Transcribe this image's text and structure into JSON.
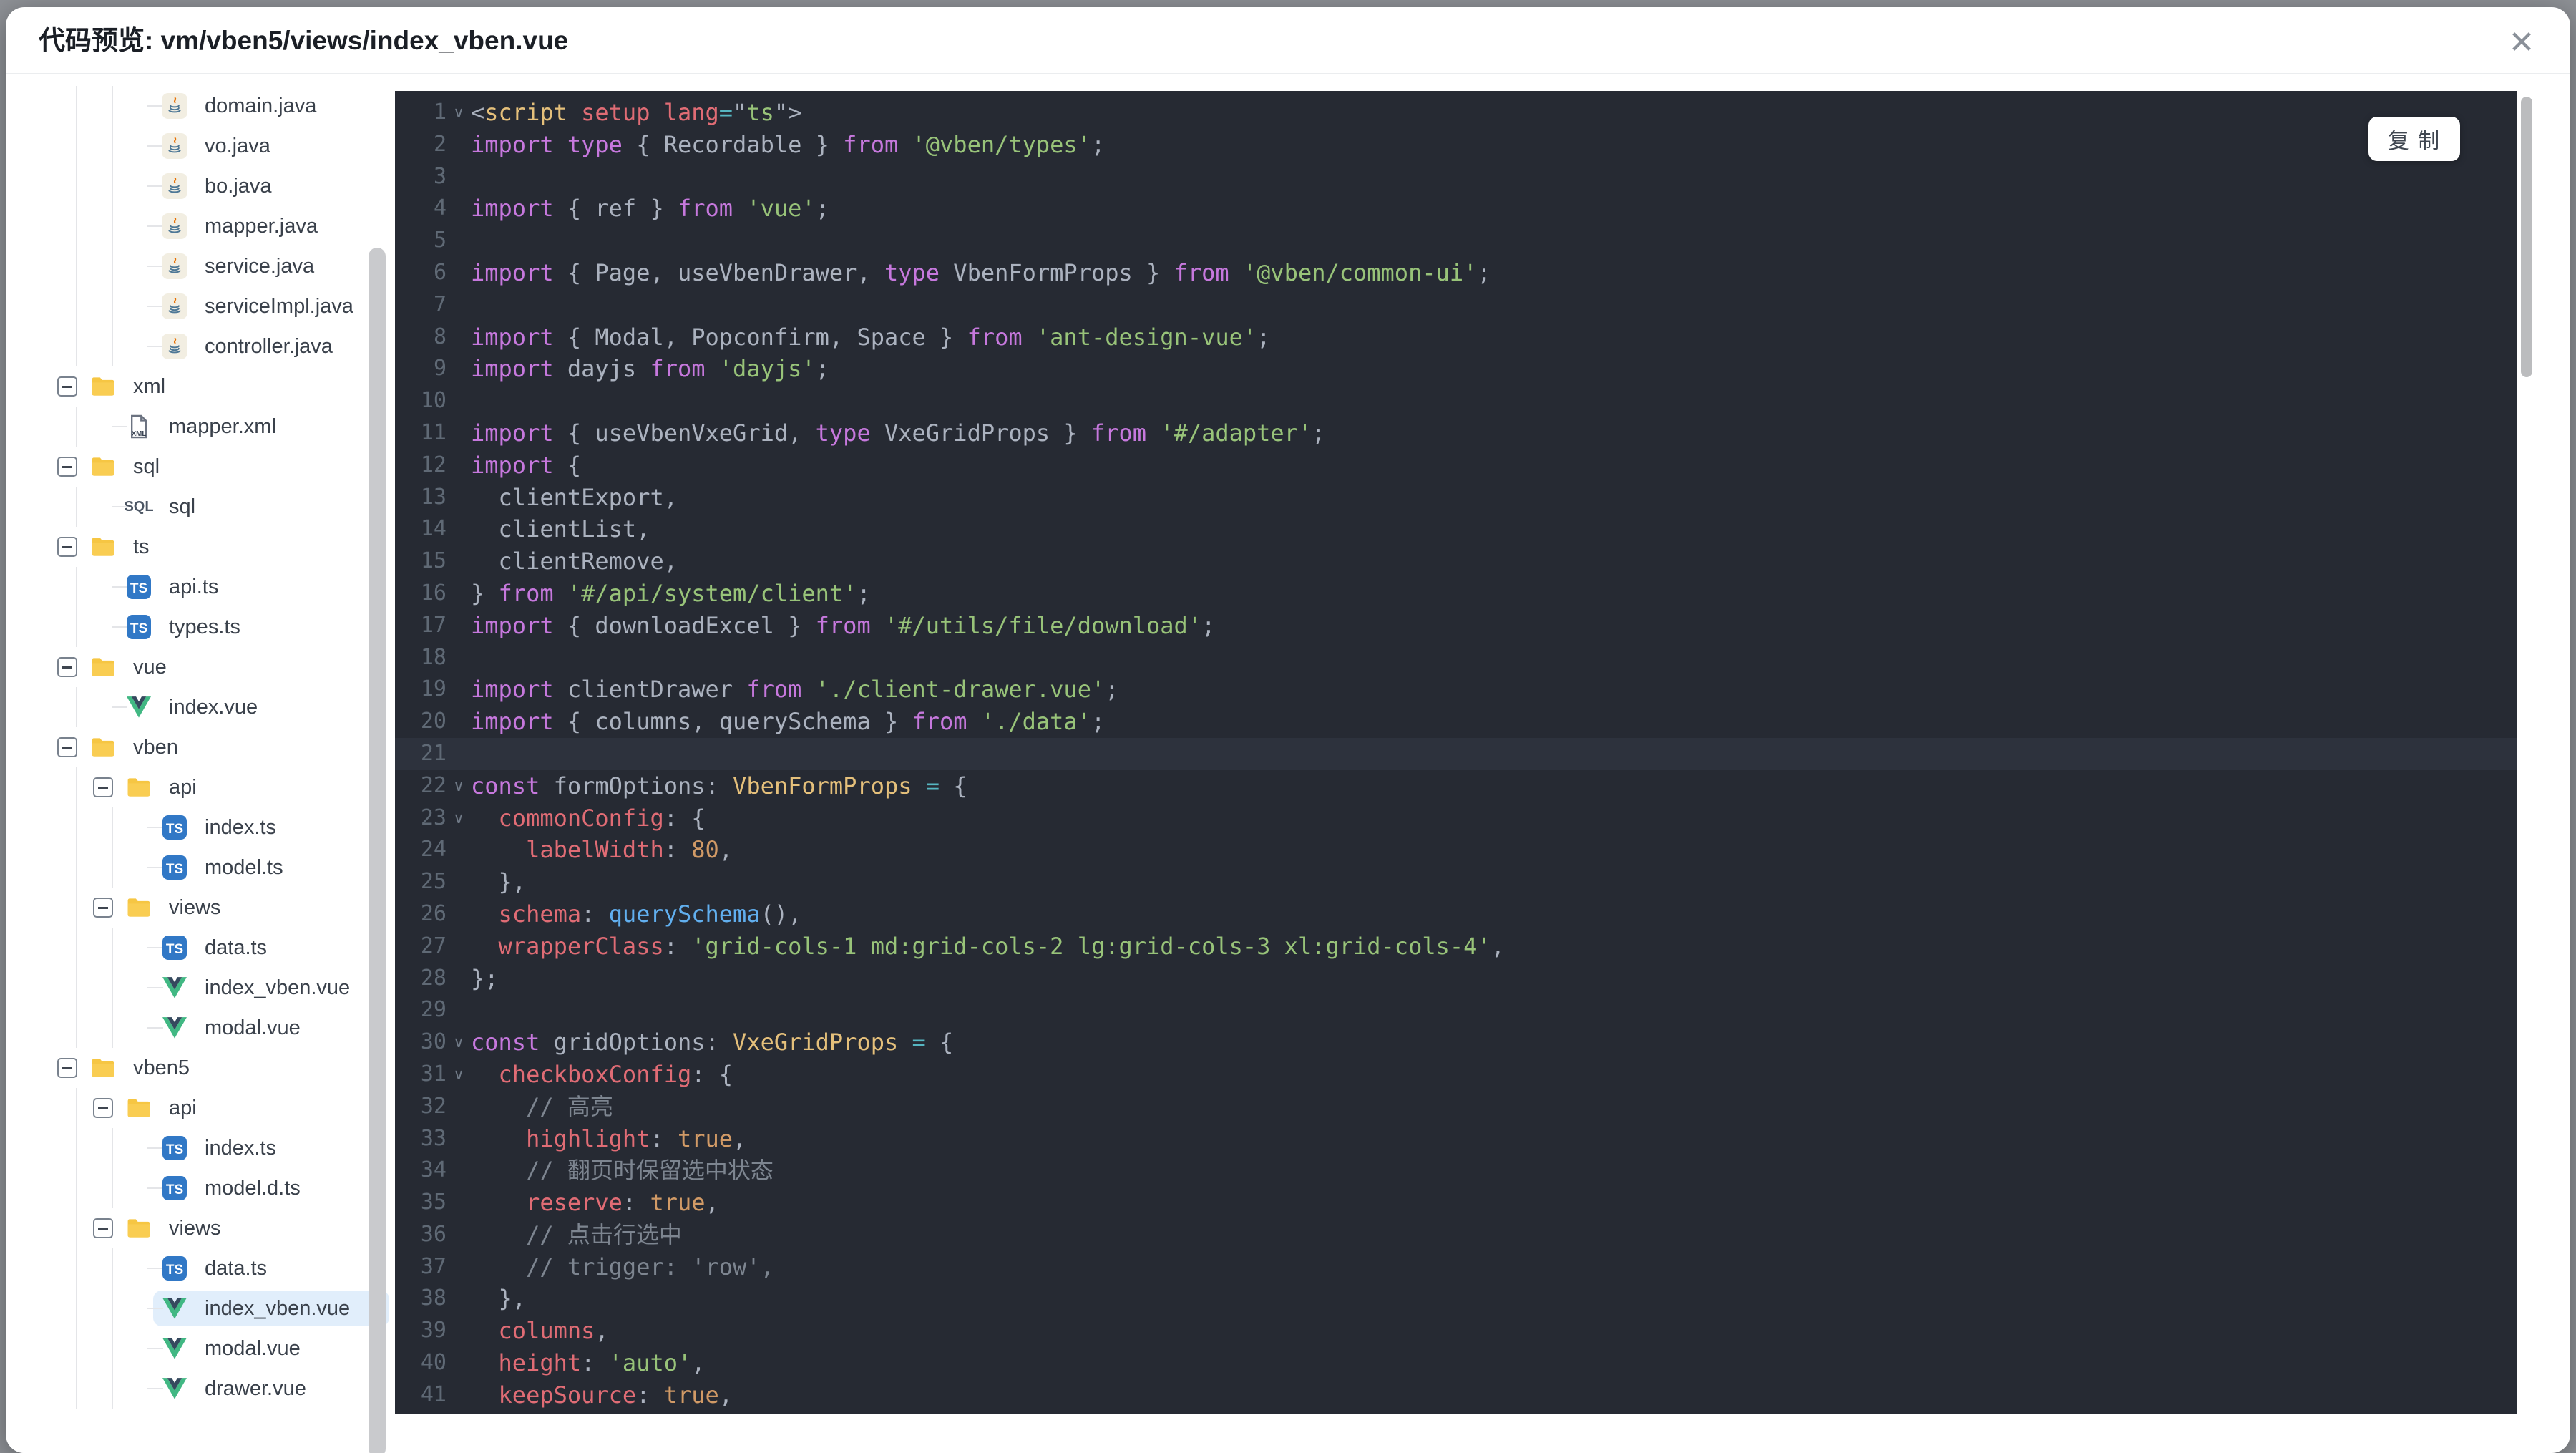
{
  "header": {
    "title": "代码预览: vm/vben5/views/index_vben.vue",
    "close_icon": "✕"
  },
  "tree": {
    "items": [
      {
        "label": "domain.java",
        "icon": "java",
        "depth": 3,
        "kind": "file"
      },
      {
        "label": "vo.java",
        "icon": "java",
        "depth": 3,
        "kind": "file"
      },
      {
        "label": "bo.java",
        "icon": "java",
        "depth": 3,
        "kind": "file"
      },
      {
        "label": "mapper.java",
        "icon": "java",
        "depth": 3,
        "kind": "file"
      },
      {
        "label": "service.java",
        "icon": "java",
        "depth": 3,
        "kind": "file"
      },
      {
        "label": "serviceImpl.java",
        "icon": "java",
        "depth": 3,
        "kind": "file"
      },
      {
        "label": "controller.java",
        "icon": "java",
        "depth": 3,
        "kind": "file"
      },
      {
        "label": "xml",
        "icon": "folder",
        "depth": 1,
        "kind": "folder",
        "expanded": true
      },
      {
        "label": "mapper.xml",
        "icon": "xml",
        "depth": 2,
        "kind": "file"
      },
      {
        "label": "sql",
        "icon": "folder",
        "depth": 1,
        "kind": "folder",
        "expanded": true
      },
      {
        "label": "sql",
        "icon": "sql",
        "depth": 2,
        "kind": "file"
      },
      {
        "label": "ts",
        "icon": "folder",
        "depth": 1,
        "kind": "folder",
        "expanded": true
      },
      {
        "label": "api.ts",
        "icon": "ts",
        "depth": 2,
        "kind": "file"
      },
      {
        "label": "types.ts",
        "icon": "ts",
        "depth": 2,
        "kind": "file"
      },
      {
        "label": "vue",
        "icon": "folder",
        "depth": 1,
        "kind": "folder",
        "expanded": true
      },
      {
        "label": "index.vue",
        "icon": "vue",
        "depth": 2,
        "kind": "file"
      },
      {
        "label": "vben",
        "icon": "folder",
        "depth": 1,
        "kind": "folder",
        "expanded": true
      },
      {
        "label": "api",
        "icon": "folder",
        "depth": 2,
        "kind": "folder",
        "expanded": true
      },
      {
        "label": "index.ts",
        "icon": "ts",
        "depth": 3,
        "kind": "file"
      },
      {
        "label": "model.ts",
        "icon": "ts",
        "depth": 3,
        "kind": "file"
      },
      {
        "label": "views",
        "icon": "folder",
        "depth": 2,
        "kind": "folder",
        "expanded": true
      },
      {
        "label": "data.ts",
        "icon": "ts",
        "depth": 3,
        "kind": "file"
      },
      {
        "label": "index_vben.vue",
        "icon": "vue",
        "depth": 3,
        "kind": "file"
      },
      {
        "label": "modal.vue",
        "icon": "vue",
        "depth": 3,
        "kind": "file"
      },
      {
        "label": "vben5",
        "icon": "folder",
        "depth": 1,
        "kind": "folder",
        "expanded": true
      },
      {
        "label": "api",
        "icon": "folder",
        "depth": 2,
        "kind": "folder",
        "expanded": true
      },
      {
        "label": "index.ts",
        "icon": "ts",
        "depth": 3,
        "kind": "file"
      },
      {
        "label": "model.d.ts",
        "icon": "ts",
        "depth": 3,
        "kind": "file"
      },
      {
        "label": "views",
        "icon": "folder",
        "depth": 2,
        "kind": "folder",
        "expanded": true
      },
      {
        "label": "data.ts",
        "icon": "ts",
        "depth": 3,
        "kind": "file"
      },
      {
        "label": "index_vben.vue",
        "icon": "vue",
        "depth": 3,
        "kind": "file",
        "selected": true
      },
      {
        "label": "modal.vue",
        "icon": "vue",
        "depth": 3,
        "kind": "file"
      },
      {
        "label": "drawer.vue",
        "icon": "vue",
        "depth": 3,
        "kind": "file"
      }
    ]
  },
  "editor": {
    "copy_button_label": "复 制",
    "active_line": 21,
    "lines": [
      {
        "n": 1,
        "fold": true,
        "t": [
          [
            "punc",
            "<"
          ],
          [
            "tag",
            "script"
          ],
          [
            "plain",
            " "
          ],
          [
            "attr",
            "setup"
          ],
          [
            "plain",
            " "
          ],
          [
            "attr",
            "lang"
          ],
          [
            "op",
            "="
          ],
          [
            "plain",
            "\""
          ],
          [
            "val",
            "ts"
          ],
          [
            "plain",
            "\""
          ],
          [
            "punc",
            ">"
          ]
        ]
      },
      {
        "n": 2,
        "t": [
          [
            "kw",
            "import type "
          ],
          [
            "punc",
            "{ "
          ],
          [
            "plain",
            "Recordable"
          ],
          [
            "punc",
            " } "
          ],
          [
            "kw",
            "from "
          ],
          [
            "str",
            "'@vben/types'"
          ],
          [
            "punc",
            ";"
          ]
        ]
      },
      {
        "n": 3,
        "t": []
      },
      {
        "n": 4,
        "t": [
          [
            "kw",
            "import "
          ],
          [
            "punc",
            "{ "
          ],
          [
            "plain",
            "ref"
          ],
          [
            "punc",
            " } "
          ],
          [
            "kw",
            "from "
          ],
          [
            "str",
            "'vue'"
          ],
          [
            "punc",
            ";"
          ]
        ]
      },
      {
        "n": 5,
        "t": []
      },
      {
        "n": 6,
        "t": [
          [
            "kw",
            "import "
          ],
          [
            "punc",
            "{ "
          ],
          [
            "plain",
            "Page, useVbenDrawer, "
          ],
          [
            "kw",
            "type "
          ],
          [
            "plain",
            "VbenFormProps"
          ],
          [
            "punc",
            " } "
          ],
          [
            "kw",
            "from "
          ],
          [
            "str",
            "'@vben/common-ui'"
          ],
          [
            "punc",
            ";"
          ]
        ]
      },
      {
        "n": 7,
        "t": []
      },
      {
        "n": 8,
        "t": [
          [
            "kw",
            "import "
          ],
          [
            "punc",
            "{ "
          ],
          [
            "plain",
            "Modal, Popconfirm, Space"
          ],
          [
            "punc",
            " } "
          ],
          [
            "kw",
            "from "
          ],
          [
            "str",
            "'ant-design-vue'"
          ],
          [
            "punc",
            ";"
          ]
        ]
      },
      {
        "n": 9,
        "t": [
          [
            "kw",
            "import "
          ],
          [
            "plain",
            "dayjs "
          ],
          [
            "kw",
            "from "
          ],
          [
            "str",
            "'dayjs'"
          ],
          [
            "punc",
            ";"
          ]
        ]
      },
      {
        "n": 10,
        "t": []
      },
      {
        "n": 11,
        "t": [
          [
            "kw",
            "import "
          ],
          [
            "punc",
            "{ "
          ],
          [
            "plain",
            "useVbenVxeGrid, "
          ],
          [
            "kw",
            "type "
          ],
          [
            "plain",
            "VxeGridProps"
          ],
          [
            "punc",
            " } "
          ],
          [
            "kw",
            "from "
          ],
          [
            "str",
            "'#/adapter'"
          ],
          [
            "punc",
            ";"
          ]
        ]
      },
      {
        "n": 12,
        "t": [
          [
            "kw",
            "import "
          ],
          [
            "punc",
            "{"
          ]
        ]
      },
      {
        "n": 13,
        "t": [
          [
            "plain",
            "  clientExport,"
          ]
        ]
      },
      {
        "n": 14,
        "t": [
          [
            "plain",
            "  clientList,"
          ]
        ]
      },
      {
        "n": 15,
        "t": [
          [
            "plain",
            "  clientRemove,"
          ]
        ]
      },
      {
        "n": 16,
        "t": [
          [
            "punc",
            "} "
          ],
          [
            "kw",
            "from "
          ],
          [
            "str",
            "'#/api/system/client'"
          ],
          [
            "punc",
            ";"
          ]
        ]
      },
      {
        "n": 17,
        "t": [
          [
            "kw",
            "import "
          ],
          [
            "punc",
            "{ "
          ],
          [
            "plain",
            "downloadExcel"
          ],
          [
            "punc",
            " } "
          ],
          [
            "kw",
            "from "
          ],
          [
            "str",
            "'#/utils/file/download'"
          ],
          [
            "punc",
            ";"
          ]
        ]
      },
      {
        "n": 18,
        "t": []
      },
      {
        "n": 19,
        "t": [
          [
            "kw",
            "import "
          ],
          [
            "plain",
            "clientDrawer "
          ],
          [
            "kw",
            "from "
          ],
          [
            "str",
            "'./client-drawer.vue'"
          ],
          [
            "punc",
            ";"
          ]
        ]
      },
      {
        "n": 20,
        "t": [
          [
            "kw",
            "import "
          ],
          [
            "punc",
            "{ "
          ],
          [
            "plain",
            "columns, querySchema"
          ],
          [
            "punc",
            " } "
          ],
          [
            "kw",
            "from "
          ],
          [
            "str",
            "'./data'"
          ],
          [
            "punc",
            ";"
          ]
        ]
      },
      {
        "n": 21,
        "t": []
      },
      {
        "n": 22,
        "fold": true,
        "t": [
          [
            "kw",
            "const "
          ],
          [
            "plain",
            "formOptions"
          ],
          [
            "punc",
            ": "
          ],
          [
            "type",
            "VbenFormProps"
          ],
          [
            "op",
            " = "
          ],
          [
            "punc",
            "{"
          ]
        ]
      },
      {
        "n": 23,
        "fold": true,
        "t": [
          [
            "prop",
            "  commonConfig"
          ],
          [
            "punc",
            ": {"
          ]
        ]
      },
      {
        "n": 24,
        "t": [
          [
            "prop",
            "    labelWidth"
          ],
          [
            "punc",
            ": "
          ],
          [
            "num",
            "80"
          ],
          [
            "punc",
            ","
          ]
        ]
      },
      {
        "n": 25,
        "t": [
          [
            "punc",
            "  },"
          ]
        ]
      },
      {
        "n": 26,
        "t": [
          [
            "prop",
            "  schema"
          ],
          [
            "punc",
            ": "
          ],
          [
            "fn",
            "querySchema"
          ],
          [
            "punc",
            "(),"
          ]
        ]
      },
      {
        "n": 27,
        "t": [
          [
            "prop",
            "  wrapperClass"
          ],
          [
            "punc",
            ": "
          ],
          [
            "str",
            "'grid-cols-1 md:grid-cols-2 lg:grid-cols-3 xl:grid-cols-4'"
          ],
          [
            "punc",
            ","
          ]
        ]
      },
      {
        "n": 28,
        "t": [
          [
            "punc",
            "};"
          ]
        ]
      },
      {
        "n": 29,
        "t": []
      },
      {
        "n": 30,
        "fold": true,
        "t": [
          [
            "kw",
            "const "
          ],
          [
            "plain",
            "gridOptions"
          ],
          [
            "punc",
            ": "
          ],
          [
            "type",
            "VxeGridProps"
          ],
          [
            "op",
            " = "
          ],
          [
            "punc",
            "{"
          ]
        ]
      },
      {
        "n": 31,
        "fold": true,
        "t": [
          [
            "prop",
            "  checkboxConfig"
          ],
          [
            "punc",
            ": {"
          ]
        ]
      },
      {
        "n": 32,
        "t": [
          [
            "comment",
            "    // 高亮"
          ]
        ]
      },
      {
        "n": 33,
        "t": [
          [
            "prop",
            "    highlight"
          ],
          [
            "punc",
            ": "
          ],
          [
            "bool",
            "true"
          ],
          [
            "punc",
            ","
          ]
        ]
      },
      {
        "n": 34,
        "t": [
          [
            "comment",
            "    // 翻页时保留选中状态"
          ]
        ]
      },
      {
        "n": 35,
        "t": [
          [
            "prop",
            "    reserve"
          ],
          [
            "punc",
            ": "
          ],
          [
            "bool",
            "true"
          ],
          [
            "punc",
            ","
          ]
        ]
      },
      {
        "n": 36,
        "t": [
          [
            "comment",
            "    // 点击行选中"
          ]
        ]
      },
      {
        "n": 37,
        "t": [
          [
            "comment",
            "    // trigger: 'row',"
          ]
        ]
      },
      {
        "n": 38,
        "t": [
          [
            "punc",
            "  },"
          ]
        ]
      },
      {
        "n": 39,
        "t": [
          [
            "prop",
            "  columns"
          ],
          [
            "punc",
            ","
          ]
        ]
      },
      {
        "n": 40,
        "t": [
          [
            "prop",
            "  height"
          ],
          [
            "punc",
            ": "
          ],
          [
            "str",
            "'auto'"
          ],
          [
            "punc",
            ","
          ]
        ]
      },
      {
        "n": 41,
        "t": [
          [
            "prop",
            "  keepSource"
          ],
          [
            "punc",
            ": "
          ],
          [
            "bool",
            "true"
          ],
          [
            "punc",
            ","
          ]
        ]
      }
    ]
  },
  "palette": {
    "page_background": "#8e9196",
    "modal_background": "#ffffff",
    "editor_background": "#262a33",
    "editor_active_line": "#2d323d",
    "keyword": "#c678dd",
    "string": "#98c379",
    "property": "#e06c75",
    "number_bool": "#d19a66",
    "type": "#e5c07b",
    "function": "#61afef",
    "operator": "#56b6c2",
    "text": "#abb2bf",
    "comment": "#7d8590",
    "line_number": "#5f6975",
    "selected_item_bg": "#e1eefb",
    "folder_icon": "#f6c643",
    "ts_icon": "#3178c6",
    "vue_icon_green": "#41b883",
    "vue_icon_dark": "#35495e"
  }
}
